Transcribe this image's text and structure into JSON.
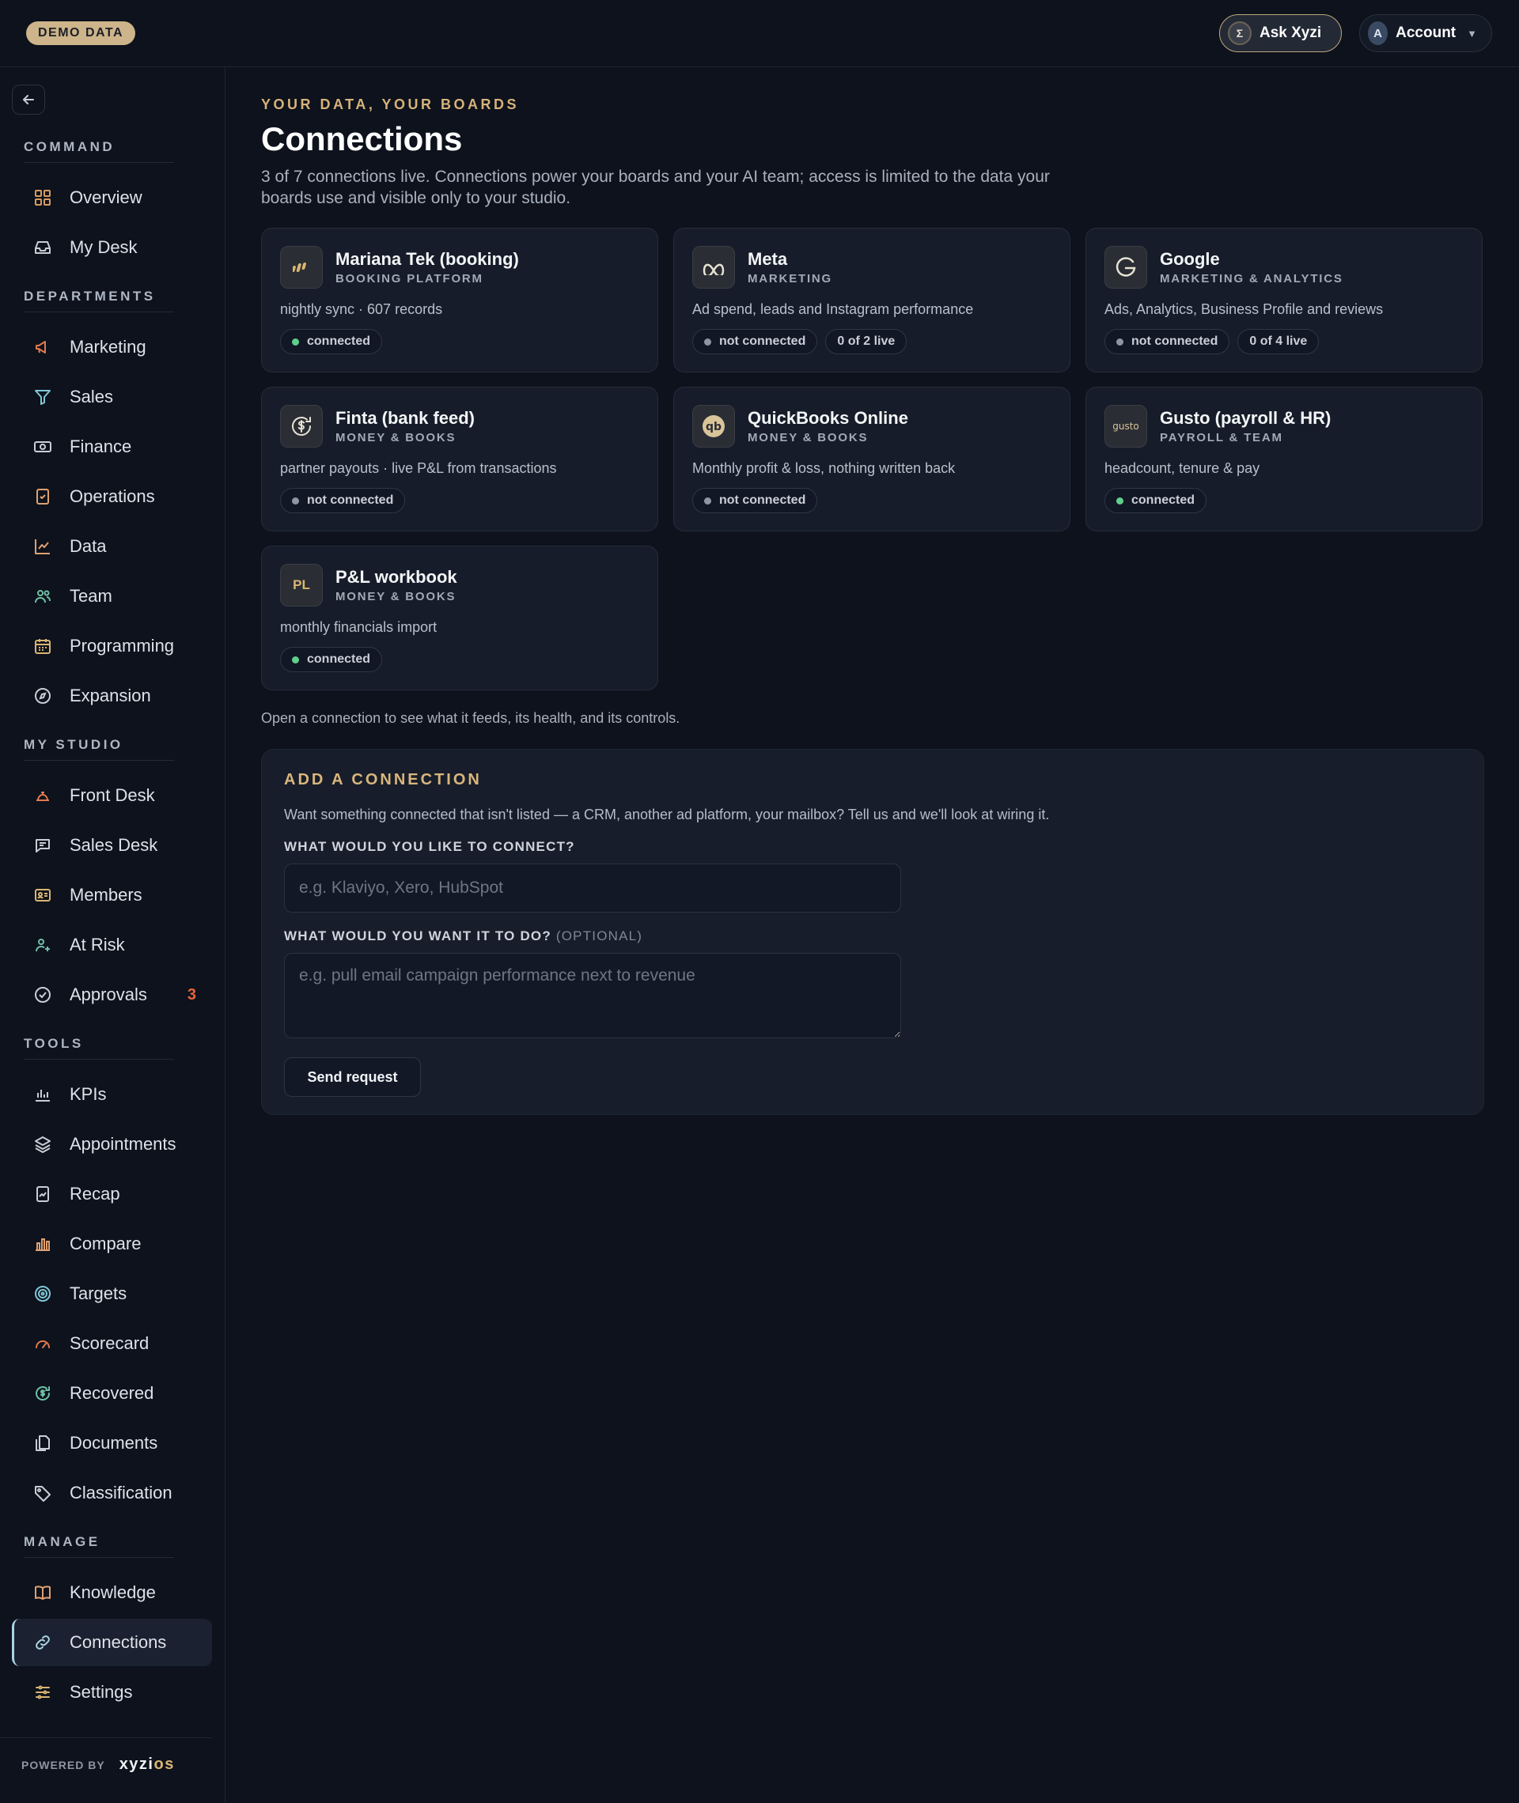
{
  "topbar": {
    "demo_badge": "DEMO DATA",
    "ask_label": "Ask Xyzi",
    "ask_icon_glyph": "Σ",
    "account_label": "Account",
    "account_initial": "A"
  },
  "sidebar": {
    "sections": {
      "command": "COMMAND",
      "departments": "DEPARTMENTS",
      "my_studio": "MY STUDIO",
      "tools": "TOOLS",
      "manage": "MANAGE"
    },
    "items": {
      "overview": "Overview",
      "my_desk": "My Desk",
      "marketing": "Marketing",
      "sales": "Sales",
      "finance": "Finance",
      "operations": "Operations",
      "data": "Data",
      "team": "Team",
      "programming": "Programming",
      "expansion": "Expansion",
      "front_desk": "Front Desk",
      "sales_desk": "Sales Desk",
      "members": "Members",
      "at_risk": "At Risk",
      "approvals": "Approvals",
      "approvals_badge": "3",
      "kpis": "KPIs",
      "appointments": "Appointments",
      "recap": "Recap",
      "compare": "Compare",
      "targets": "Targets",
      "scorecard": "Scorecard",
      "recovered": "Recovered",
      "documents": "Documents",
      "classification": "Classification",
      "knowledge": "Knowledge",
      "connections": "Connections",
      "settings": "Settings"
    },
    "active_item": "connections",
    "powered_by": "POWERED BY",
    "brand_main": "xyzi",
    "brand_accent": "os"
  },
  "main": {
    "eyebrow": "YOUR DATA, YOUR BOARDS",
    "title": "Connections",
    "intro": "3 of 7 connections live. Connections power your boards and your AI team; access is limited to the data your boards use and visible only to your studio.",
    "hint": "Open a connection to see what it feeds, its health, and its controls."
  },
  "connections": [
    {
      "name": "Mariana Tek (booking)",
      "category": "BOOKING PLATFORM",
      "description": "nightly sync · 607 records",
      "status": "connected",
      "extra": ""
    },
    {
      "name": "Meta",
      "category": "MARKETING",
      "description": "Ad spend, leads and Instagram performance",
      "status": "not connected",
      "extra": "0 of 2 live"
    },
    {
      "name": "Google",
      "category": "MARKETING & ANALYTICS",
      "description": "Ads, Analytics, Business Profile and reviews",
      "status": "not connected",
      "extra": "0 of 4 live"
    },
    {
      "name": "Finta (bank feed)",
      "category": "MONEY & BOOKS",
      "description": "partner payouts · live P&L from transactions",
      "status": "not connected",
      "extra": ""
    },
    {
      "name": "QuickBooks Online",
      "category": "MONEY & BOOKS",
      "description": "Monthly profit & loss, nothing written back",
      "status": "not connected",
      "extra": ""
    },
    {
      "name": "Gusto (payroll & HR)",
      "category": "PAYROLL & TEAM",
      "description": "headcount, tenure & pay",
      "status": "connected",
      "extra": "",
      "logo_text": "gusto"
    },
    {
      "name": "P&L workbook",
      "category": "MONEY & BOOKS",
      "description": "monthly financials import",
      "status": "connected",
      "extra": "",
      "logo_text": "PL"
    }
  ],
  "add_connection": {
    "title": "ADD A CONNECTION",
    "description": "Want something connected that isn't listed — a CRM, another ad platform, your mailbox? Tell us and we'll look at wiring it.",
    "connect_label": "WHAT WOULD YOU LIKE TO CONNECT?",
    "connect_placeholder": "e.g. Klaviyo, Xero, HubSpot",
    "purpose_label": "WHAT WOULD YOU WANT IT TO DO?",
    "purpose_optional": "(OPTIONAL)",
    "purpose_placeholder": "e.g. pull email campaign performance next to revenue",
    "send_label": "Send request"
  },
  "colors": {
    "accent_gold": "#d7b27a",
    "connected_green": "#5fcf8a",
    "badge_orange": "#e8653a",
    "background": "#0d121c",
    "card": "#161c29"
  }
}
